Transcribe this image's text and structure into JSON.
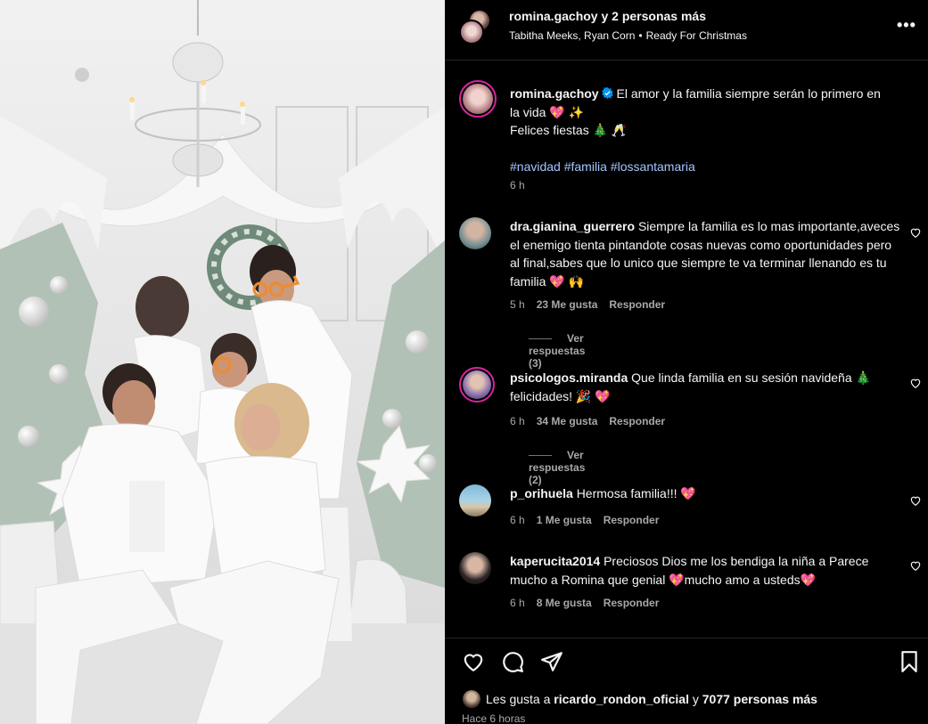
{
  "header": {
    "title_user": "romina.gachoy",
    "title_rest": "y 2 personas más",
    "collaborators": "Tabitha Meeks, Ryan Corn",
    "separator": "•",
    "song": "Ready For Christmas",
    "more_label": "•••"
  },
  "caption": {
    "user": "romina.gachoy",
    "line1": "El amor y la familia siempre serán lo primero en",
    "line2": "la vida 💖 ✨",
    "line3": "Felices fiestas 🎄 🥂",
    "hashtags": "#navidad #familia #lossantamaria",
    "time": "6 h"
  },
  "comments": [
    {
      "user": "dra.gianina_guerrero",
      "text": "Siempre la familia es lo mas importante,aveces el enemigo tienta pintandote cosas nuevas como oportunidades pero al final,sabes que lo unico que siempre te va terminar llenando es tu familia 💖 🙌",
      "time": "5 h",
      "likes": "23 Me gusta",
      "reply": "Responder",
      "view_replies": "Ver respuestas (3)"
    },
    {
      "user": "psicologos.miranda",
      "text": "Que linda familia en su sesión navideña 🎄 felicidades! 🎉 💖",
      "time": "6 h",
      "likes": "34 Me gusta",
      "reply": "Responder",
      "view_replies": "Ver respuestas (2)"
    },
    {
      "user": "p_orihuela",
      "text": "Hermosa familia!!! 💖",
      "time": "6 h",
      "likes": "1 Me gusta",
      "reply": "Responder"
    },
    {
      "user": "kaperucita2014",
      "text": "Preciosos Dios me los bendiga la niña a Parece mucho a Romina que genial 💖mucho amo a usteds💖",
      "time": "6 h",
      "likes": "8 Me gusta",
      "reply": "Responder"
    }
  ],
  "footer": {
    "likes_prefix": "Les gusta a",
    "likes_user": "ricardo_rondon_oficial",
    "likes_middle": "y",
    "likes_count": "7077 personas más",
    "posted": "Hace 6 horas"
  },
  "icons": {
    "like": "heart-icon",
    "comment": "comment-icon",
    "share": "paper-plane-icon",
    "save": "bookmark-icon",
    "verified": "verified-badge-icon",
    "more": "more-options-icon"
  },
  "colors": {
    "background": "#000000",
    "text": "#f5f5f5",
    "muted": "#a8a8a8",
    "hashtag": "#a6c6ff",
    "verified": "#0095f6"
  }
}
